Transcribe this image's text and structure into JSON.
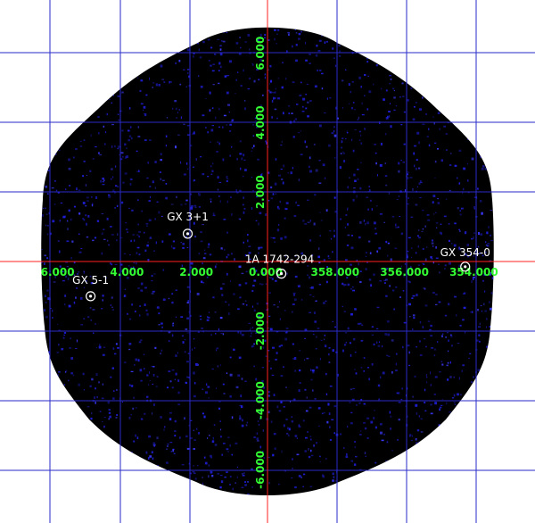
{
  "colors": {
    "background": "#ffffff",
    "field": "#000000",
    "noise": "#1f1fd8",
    "grid": "#2a2ac8",
    "axis": "#ff2020",
    "tick_label": "#33ff33",
    "source": "#ffffff"
  },
  "axes": {
    "longitude_ticks": [
      "6.000",
      "4.000",
      "2.000",
      "0.000",
      "358.000",
      "356.000",
      "354.000"
    ],
    "latitude_ticks": [
      "6.000",
      "4.000",
      "2.000",
      "-2.000",
      "-4.000",
      "-6.000"
    ]
  },
  "sources": [
    {
      "name": "GX 3+1",
      "lon": 2.3,
      "lat": 0.8
    },
    {
      "name": "1A 1742-294",
      "lon": 359.6,
      "lat": -0.35
    },
    {
      "name": "GX 354-0",
      "lon": 354.3,
      "lat": -0.15
    },
    {
      "name": "GX 5-1",
      "lon": 5.1,
      "lat": -1.0
    }
  ]
}
